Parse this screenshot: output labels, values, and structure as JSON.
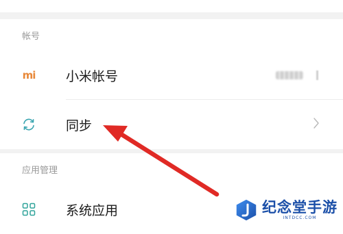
{
  "sections": [
    {
      "title": "帐号",
      "rows": [
        {
          "label": "小米帐号",
          "icon": "mi-logo-icon",
          "logo_text": "mi"
        },
        {
          "label": "同步",
          "icon": "sync-icon"
        }
      ]
    },
    {
      "title": "应用管理",
      "rows": [
        {
          "label": "系统应用",
          "icon": "grid-apps-icon"
        }
      ]
    }
  ],
  "colors": {
    "background": "#f2f2f2",
    "mi_orange": "#e8893a",
    "sync_teal": "#3aa5b0",
    "apps_teal": "#2fa39a",
    "arrow_red": "#e02a25",
    "watermark_blue": "#1b4fa8"
  },
  "annotation": {
    "type": "red-arrow",
    "points_to": "同步"
  },
  "watermark": {
    "text": "纪念堂手游",
    "url": "INTDCC.COM"
  }
}
